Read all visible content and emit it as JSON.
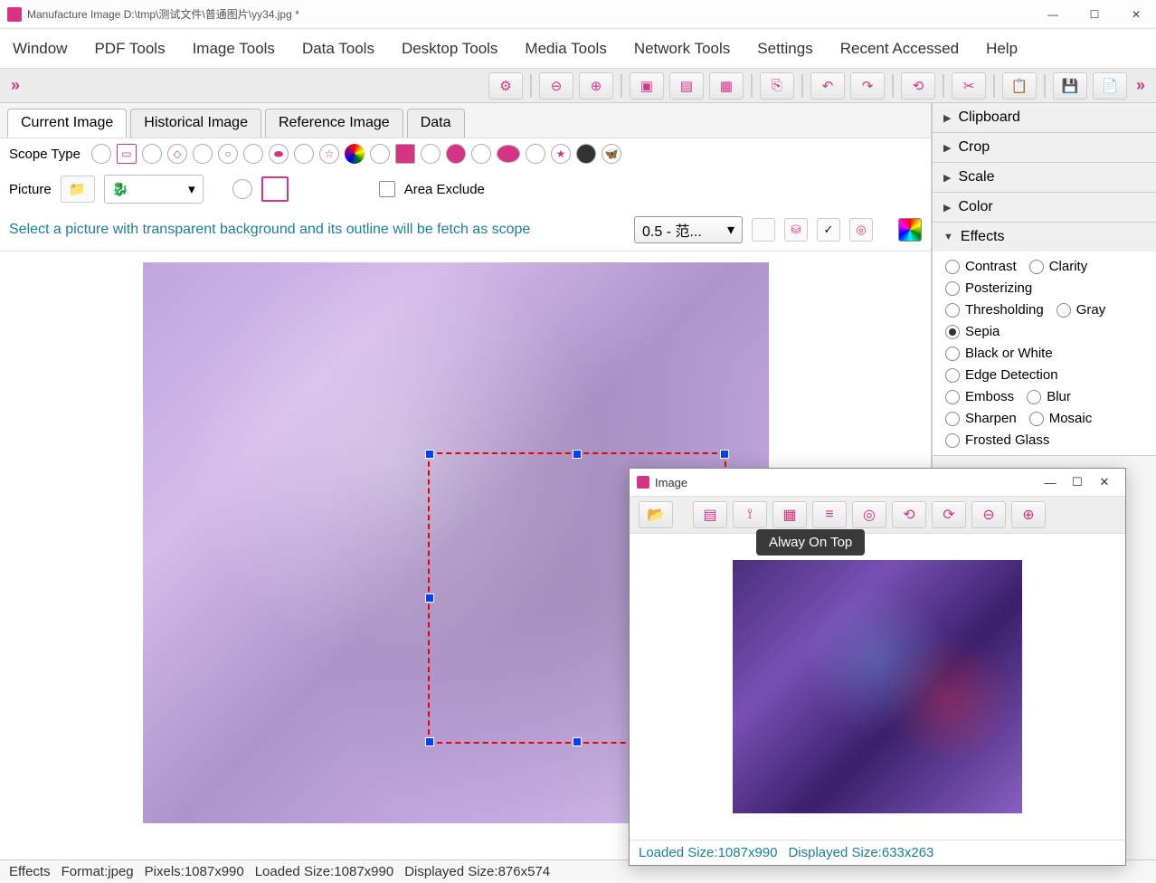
{
  "window": {
    "title": "Manufacture Image D:\\tmp\\测试文件\\普通图片\\yy34.jpg *"
  },
  "menu": [
    "Window",
    "PDF Tools",
    "Image Tools",
    "Data Tools",
    "Desktop Tools",
    "Media Tools",
    "Network Tools",
    "Settings",
    "Recent Accessed",
    "Help"
  ],
  "toolbar_icons": [
    "⚙",
    "⊖",
    "⊕",
    "▣",
    "▤",
    "▦",
    "⎘",
    "↶",
    "↷",
    "⟲",
    "✂",
    "📋",
    "💾",
    "📄"
  ],
  "tabs": {
    "items": [
      "Current Image",
      "Historical Image",
      "Reference Image",
      "Data"
    ],
    "active": 0
  },
  "scope": {
    "label": "Scope Type"
  },
  "picture": {
    "label": "Picture",
    "area_exclude": "Area Exclude"
  },
  "info_row": {
    "text": "Select a picture with transparent background and its outline will be fetch as scope",
    "range": "0.5 - 范..."
  },
  "statusbar": {
    "effects": "Effects",
    "format": "Format:jpeg",
    "pixels": "Pixels:1087x990",
    "loaded": "Loaded Size:1087x990",
    "displayed": "Displayed Size:876x574"
  },
  "right_panel": {
    "sections": [
      "Clipboard",
      "Crop",
      "Scale",
      "Color",
      "Effects"
    ],
    "expanded": 4,
    "effects": {
      "contrast": "Contrast",
      "clarity": "Clarity",
      "posterizing": "Posterizing",
      "thresholding": "Thresholding",
      "gray": "Gray",
      "sepia": "Sepia",
      "black_white": "Black or White",
      "edge": "Edge Detection",
      "emboss": "Emboss",
      "blur": "Blur",
      "sharpen": "Sharpen",
      "mosaic": "Mosaic",
      "frosted": "Frosted Glass",
      "selected": "sepia"
    }
  },
  "float_window": {
    "title": "Image",
    "tooltip": "Alway On Top",
    "toolbar_icons": [
      "📂",
      "▤",
      "⟟",
      "▦",
      "≡",
      "⟲",
      "⟳",
      "⊖",
      "⊕"
    ],
    "status": {
      "loaded": "Loaded Size:1087x990",
      "displayed": "Displayed Size:633x263"
    }
  }
}
